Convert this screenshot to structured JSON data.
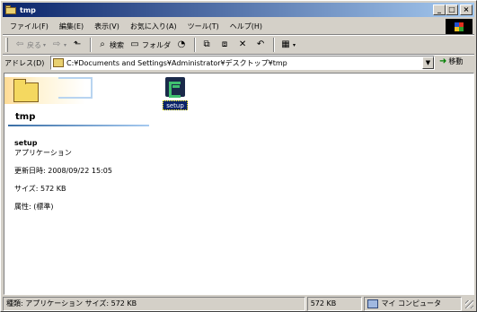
{
  "window": {
    "title": "tmp",
    "controls": {
      "minimize": "_",
      "maximize": "□",
      "close": "×"
    }
  },
  "menubar": {
    "items": [
      "ファイル(F)",
      "編集(E)",
      "表示(V)",
      "お気に入り(A)",
      "ツール(T)",
      "ヘルプ(H)"
    ]
  },
  "toolbar": {
    "back_label": "戻る",
    "search_label": "検索",
    "folders_label": "フォルダ",
    "icons": [
      "back-arrow-icon",
      "forward-arrow-icon",
      "up-folder-icon",
      "search-icon",
      "folders-icon",
      "history-icon",
      "move-to-icon",
      "copy-to-icon",
      "delete-icon",
      "undo-icon",
      "views-icon"
    ]
  },
  "address": {
    "label": "アドレス(D)",
    "path": "C:¥Documents and Settings¥Administrator¥デスクトップ¥tmp",
    "go_label": "移動"
  },
  "content": {
    "folder_title": "tmp",
    "details": {
      "name": "setup",
      "type": "アプリケーション",
      "modified": "更新日時: 2008/09/22 15:05",
      "size": "サイズ: 572 KB",
      "attributes": "属性: (標準)"
    },
    "files": [
      {
        "name": "setup",
        "icon": "setup-app-icon",
        "selected": true
      }
    ]
  },
  "statusbar": {
    "description": "種類: アプリケーション サイズ: 572 KB",
    "size": "572 KB",
    "zone": "マイ コンピュータ"
  },
  "colors": {
    "titlebar_start": "#0a246a",
    "titlebar_end": "#a6caf0",
    "face": "#d4d0c8",
    "selection": "#0a246a"
  }
}
